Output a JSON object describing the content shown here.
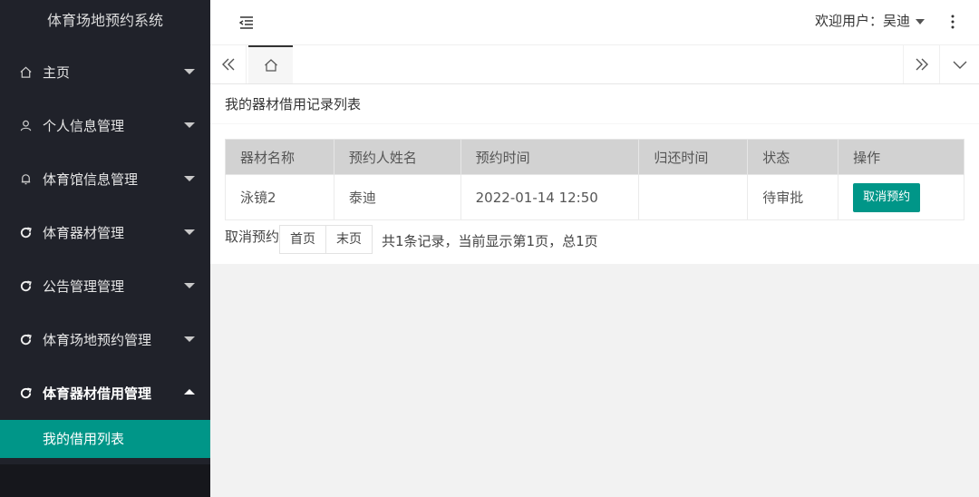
{
  "app": {
    "title": "体育场地预约系统"
  },
  "sidebar": {
    "items": [
      {
        "label": "主页",
        "icon": "home-icon"
      },
      {
        "label": "个人信息管理",
        "icon": "user-icon"
      },
      {
        "label": "体育馆信息管理",
        "icon": "bell-icon"
      },
      {
        "label": "体育器材管理",
        "icon": "refresh-icon"
      },
      {
        "label": "公告管理管理",
        "icon": "refresh-icon"
      },
      {
        "label": "体育场地预约管理",
        "icon": "refresh-icon"
      },
      {
        "label": "体育器材借用管理",
        "icon": "refresh-icon"
      }
    ],
    "sub_items": [
      {
        "label": "我的借用列表"
      }
    ]
  },
  "header": {
    "user_label": "欢迎用户：吴迪"
  },
  "main": {
    "title": "我的器材借用记录列表",
    "table": {
      "columns": [
        "器材名称",
        "预约人姓名",
        "预约时间",
        "归还时间",
        "状态",
        "操作"
      ],
      "rows": [
        {
          "equipment": "泳镜2",
          "name": "泰迪",
          "reserve_time": "2022-01-14 12:50",
          "return_time": "",
          "status": "待审批",
          "action": "取消预约"
        }
      ]
    },
    "pager": {
      "label": "取消预约",
      "first": "首页",
      "last": "末页",
      "info": "共1条记录，当前显示第1页，总1页"
    }
  },
  "colors": {
    "accent": "#009688",
    "sidebar_bg": "#20222a",
    "status": "#1e1ec8"
  }
}
